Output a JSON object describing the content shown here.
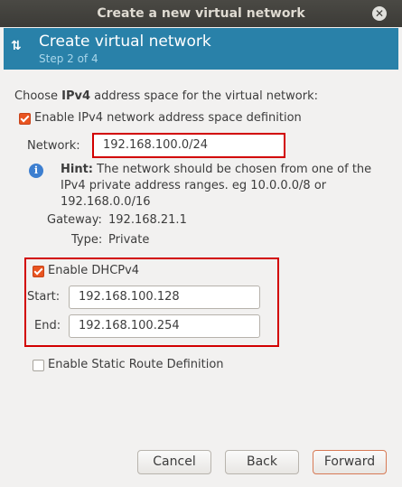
{
  "window": {
    "title": "Create a new virtual network",
    "close_glyph": "✕"
  },
  "header": {
    "title": "Create virtual network",
    "step": "Step 2 of 4"
  },
  "intro": {
    "prefix": "Choose ",
    "bold": "IPv4",
    "suffix": " address space for the virtual network:"
  },
  "enable_ipv4": {
    "label": "Enable IPv4 network address space definition",
    "checked": true
  },
  "network": {
    "label": "Network:",
    "value": "192.168.100.0/24"
  },
  "hint": {
    "bold": "Hint:",
    "text": " The network should be chosen from one of the IPv4 private address ranges. eg 10.0.0.0/8 or 192.168.0.0/16"
  },
  "gateway": {
    "label": "Gateway:",
    "value": "192.168.21.1"
  },
  "type": {
    "label": "Type:",
    "value": "Private"
  },
  "dhcp": {
    "label": "Enable DHCPv4",
    "checked": true,
    "start_label": "Start:",
    "start_value": "192.168.100.128",
    "end_label": "End:",
    "end_value": "192.168.100.254"
  },
  "static_route": {
    "label": "Enable Static Route Definition",
    "checked": false
  },
  "buttons": {
    "cancel": "Cancel",
    "back": "Back",
    "forward": "Forward"
  },
  "colors": {
    "accent": "#2981a9",
    "checkbox": "#e95420",
    "highlight": "#d20000"
  }
}
